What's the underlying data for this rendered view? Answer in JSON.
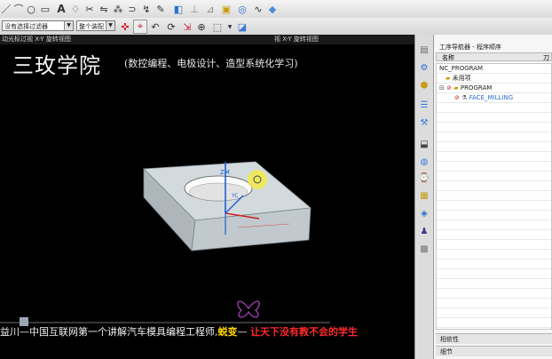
{
  "toolbar": {
    "type_filter": "没有选择过滤器",
    "assembly_filter": "整个装配",
    "icons_row1": [
      "line-icon",
      "arc-icon",
      "circle-icon",
      "rectangle-icon",
      "text-icon",
      "shape-icon",
      "trim-icon",
      "mirror-icon",
      "pattern-icon",
      "offset-icon",
      "project-icon",
      "sketch-icon",
      "toggle-icon",
      "constraint-icon",
      "inferred-icon",
      "cube-icon",
      "tint-icon"
    ]
  },
  "viewport": {
    "left_caption": "动光标过视 X-Y 旋转视图",
    "right_caption": "视 X-Y 旋转视图",
    "brand": "三玫学院",
    "subtitle": "(数控编程、电极设计、造型系统化学习)",
    "axis_labels": {
      "zm": "ZM",
      "yc": "YC"
    },
    "footer_prefix": "益川—中国互联网第一个讲解汽车模具编程工程师,",
    "footer_highlight": "蜕变",
    "footer_dash": "—",
    "footer_slogan": "让天下没有教不会的学生"
  },
  "navigator": {
    "title": "工序导航器 - 程序顺序",
    "col_name": "名称",
    "col_extra": "刀",
    "rows": [
      {
        "label": "NC_PROGRAM",
        "indent": 0
      },
      {
        "label": "未用项",
        "indent": 1
      },
      {
        "label": "PROGRAM",
        "indent": 1
      },
      {
        "label": "FACE_MILLING",
        "indent": 2
      }
    ],
    "panel_details": "相依性",
    "panel_details2": "细节"
  },
  "colors": {
    "viewport_bg": "#000000",
    "highlight_yellow": "#ffd600",
    "slogan_red": "#ff2a2a",
    "part_face": "#cfd6dc"
  }
}
